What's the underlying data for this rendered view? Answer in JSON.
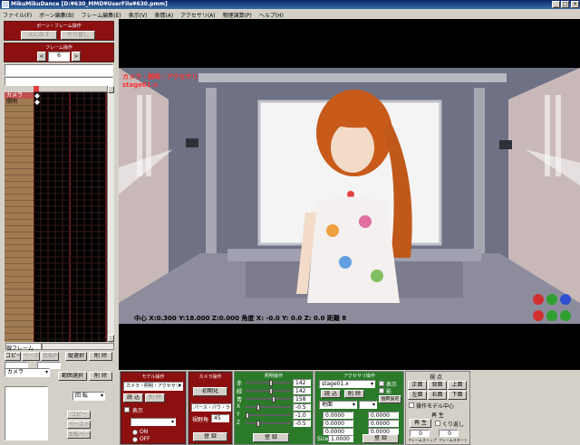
{
  "window": {
    "title": "MikuMikuDance [D:¥630_MMD¥UserFile¥630.pmm]",
    "min": "_",
    "max": "□",
    "close": "×"
  },
  "menu": [
    "ファイル(F)",
    "ボーン編集(B)",
    "フレーム編集(E)",
    "表示(V)",
    "表情(A)",
    "アクセサリ(A)",
    "物理演算(P)",
    "ヘルプ(H)"
  ],
  "left": {
    "bone_frame_header": "ボーン・フレーム操作",
    "paste": "元に戻す",
    "undo": "やり直し",
    "frame_header": "フレーム操作",
    "frame_value": "6",
    "prev": "<",
    "next": ">",
    "tracks": [
      "カメラ",
      "照明"
    ],
    "current_frame_label": "現フレーム",
    "copy": "コピー",
    "paste2": "ペースト",
    "reverse_paste": "反転P",
    "vertical_select": "縦選択",
    "delete": "削 除",
    "range_select": "範囲選択",
    "frame_delete": "削 除",
    "camera_select": "カメラ",
    "rotate": "回 転",
    "copy2": "コピー",
    "paste3": "ペースト",
    "reverse_paste2": "反転ペースト"
  },
  "viewport": {
    "mode_label": "カメラ・照明・アクセサリ",
    "accessory_name": "stage01.x",
    "status": "中心 X:0.300 Y:18.000 Z:0.000   角度 X: -0.0 Y: 0.0 Z: 0.0  距離 8"
  },
  "model_panel": {
    "header": "モデル操作",
    "model_select": "カメラ・照明・アクセサリ",
    "load": "読 込",
    "delete": "削 除",
    "display": "表示",
    "on": "ON",
    "off": "OFF"
  },
  "camera_panel": {
    "header": "カメラ操作",
    "reset": "初期化",
    "perspective": "パース・パウ・ライン",
    "fov_label": "視野角",
    "fov_value": "45",
    "register": "登 録"
  },
  "light_panel": {
    "header": "照明操作",
    "labels": [
      "赤",
      "緑",
      "青",
      "X",
      "Y",
      "Z"
    ],
    "values": [
      "142",
      "142",
      "158",
      "-0.5",
      "-1.0",
      "-0.5"
    ],
    "fractions": [
      0.56,
      0.56,
      0.62,
      0.25,
      0.0,
      0.25
    ],
    "register": "登 録"
  },
  "accessory_panel": {
    "header": "アクセサリ操作",
    "select": "stage01.x",
    "display": "表示",
    "shadow": "影",
    "load": "読 込",
    "delete": "削 除",
    "settings": "個数設定",
    "ground": "地面",
    "x": "0.0000",
    "y": "0.0000",
    "z": "0.0000",
    "rx": "0.0000",
    "ry": "0.0000",
    "rz": "0.0000",
    "size_label": "Size",
    "size": "1.0000",
    "register": "登 録"
  },
  "view_panel": {
    "header": "視 点",
    "front": "正面",
    "back": "背面",
    "top": "上面",
    "left": "左面",
    "right": "右面",
    "bottom": "下面",
    "model_center": "操作モデル中心",
    "play_header": "再 生",
    "play": "再 生",
    "loop": "くり返し",
    "from": "0",
    "to": "0",
    "frame_stop": "フレームストップ",
    "frame_start": "フレームスタート"
  },
  "colors": {
    "accent_red": "#8c1010",
    "track_brown": "#a07a50",
    "timeline_bg": "#000000",
    "keyframe": "#ffffff",
    "title_blue": "#0a246a"
  }
}
